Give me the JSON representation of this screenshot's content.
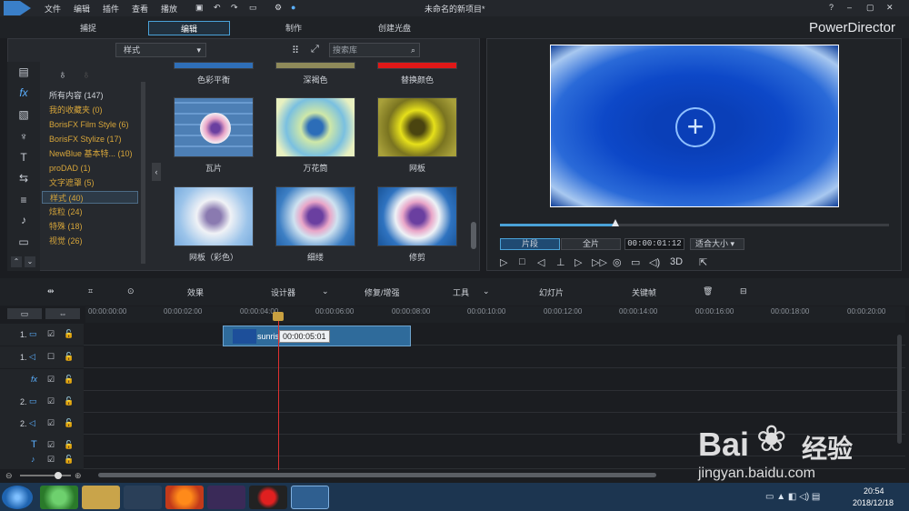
{
  "menu": [
    "文件",
    "编辑",
    "插件",
    "查看",
    "播放"
  ],
  "window_title": "未命名的新项目*",
  "app_brand": "PowerDirector",
  "modes": [
    "捕捉",
    "编辑",
    "制作",
    "创建光盘"
  ],
  "library": {
    "dropdown": "样式",
    "search_placeholder": "搜索库"
  },
  "categories": [
    "所有内容 (147)",
    "我的收藏夹 (0)",
    "BorisFX Film Style (6)",
    "BorisFX Stylize (17)",
    "NewBlue 基本特... (10)",
    "proDAD (1)",
    "文字遮罩 (5)",
    "样式 (40)",
    "炫粒 (24)",
    "特殊 (18)",
    "视觉 (26)"
  ],
  "effects_top": [
    "色彩平衡",
    "深褐色",
    "替换颜色"
  ],
  "effects": [
    "瓦片",
    "万花筒",
    "网板",
    "网板（彩色）",
    "细缕",
    "修剪"
  ],
  "preview": {
    "seg_clip": "片段",
    "seg_movie": "全片",
    "timecode": "00:00:01:12",
    "fit": "适合大小",
    "mode3d": "3D"
  },
  "controls": [
    "效果",
    "设计器",
    "修复/增强",
    "工具",
    "幻灯片",
    "关键帧"
  ],
  "ruler": [
    "00:00:00:00",
    "00:00:02:00",
    "00:00:04:00",
    "00:00:06:00",
    "00:00:08:00",
    "00:00:10:00",
    "00:00:12:00",
    "00:00:14:00",
    "00:00:16:00",
    "00:00:18:00",
    "00:00:20:00"
  ],
  "tracks": [
    "1.",
    "1.",
    "",
    "2.",
    "2.",
    "",
    ""
  ],
  "clip": {
    "name": "sunris",
    "tooltip": "00:00:05:01"
  },
  "clock": {
    "time": "20:54",
    "date": "2018/12/18"
  },
  "watermark": {
    "text1": "Bai",
    "text2": "经验",
    "url": "jingyan.baidu.com"
  }
}
